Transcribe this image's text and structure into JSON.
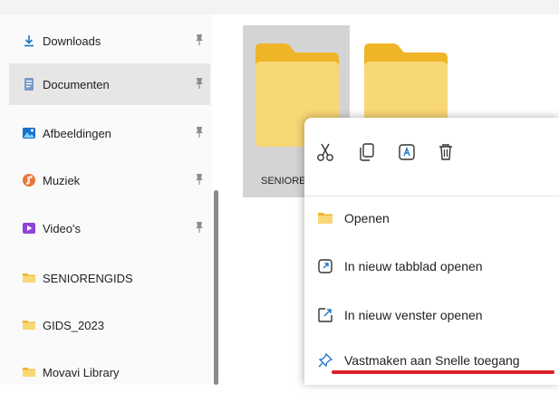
{
  "nav": {
    "items": [
      {
        "label": "Downloads",
        "icon": "download-icon",
        "pinned": true
      },
      {
        "label": "Documenten",
        "icon": "document-icon",
        "pinned": true,
        "selected": true
      },
      {
        "label": "Afbeeldingen",
        "icon": "pictures-icon",
        "pinned": true
      },
      {
        "label": "Muziek",
        "icon": "music-icon",
        "pinned": true
      },
      {
        "label": "Video's",
        "icon": "video-icon",
        "pinned": true
      },
      {
        "label": "SENIORENGIDS",
        "icon": "folder-icon",
        "pinned": false
      },
      {
        "label": "GIDS_2023",
        "icon": "folder-icon",
        "pinned": false
      },
      {
        "label": "Movavi Library",
        "icon": "folder-icon",
        "pinned": false
      }
    ]
  },
  "content": {
    "selected_folder_label": "SENIORE"
  },
  "context_menu": {
    "toolbar": [
      "cut-icon",
      "copy-icon",
      "rename-icon",
      "delete-icon"
    ],
    "items": [
      {
        "label": "Openen",
        "icon": "folder-icon"
      },
      {
        "label": "In nieuw tabblad openen",
        "icon": "new-tab-icon"
      },
      {
        "label": "In nieuw venster openen",
        "icon": "new-window-icon"
      },
      {
        "label": "Vastmaken aan Snelle toegang",
        "icon": "pin-icon",
        "highlighted": true
      }
    ]
  },
  "colors": {
    "folder": "#f8d775",
    "folder_tab": "#f0b429",
    "selection": "#d4d4d4",
    "underline": "#d9202a"
  }
}
